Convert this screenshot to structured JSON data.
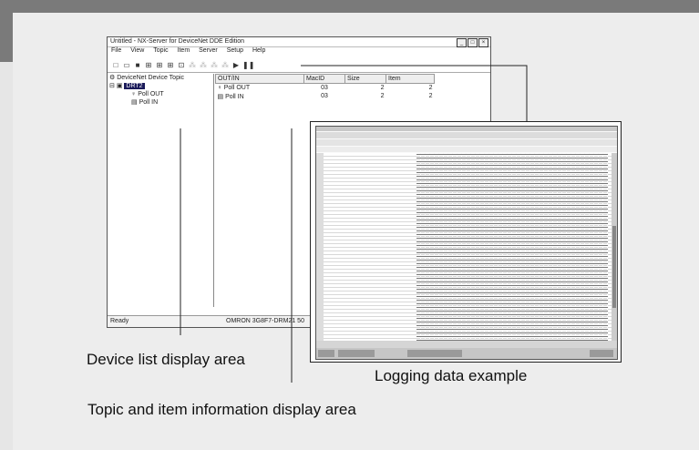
{
  "window": {
    "title": "Untitled - NX-Server for DeviceNet DDE Edition",
    "controls": [
      "_",
      "□",
      "×"
    ]
  },
  "menu": [
    "File",
    "View",
    "Topic",
    "Item",
    "Server",
    "Setup",
    "Help"
  ],
  "tree": {
    "root": "DeviceNet Device Topic",
    "node": "DRT2",
    "children": [
      "Poll OUT",
      "Poll IN"
    ]
  },
  "table": {
    "headers": [
      "OUT/IN",
      "MacID",
      "Size",
      "Item"
    ],
    "rows": [
      {
        "name": "Poll OUT",
        "macid": "03",
        "size": "2",
        "item": "2"
      },
      {
        "name": "Poll IN",
        "macid": "03",
        "size": "2",
        "item": "2"
      }
    ]
  },
  "status": {
    "left": "Ready",
    "right": "OMRON 3G8F7-DRM21 50"
  },
  "labels": {
    "device_list": "Device list display area",
    "logging": "Logging data example",
    "topic_item": "Topic and item information display area"
  },
  "colors": {
    "background": "#e6e6e6",
    "header_band": "#7a7a7a",
    "selection": "#1a1a5a"
  }
}
